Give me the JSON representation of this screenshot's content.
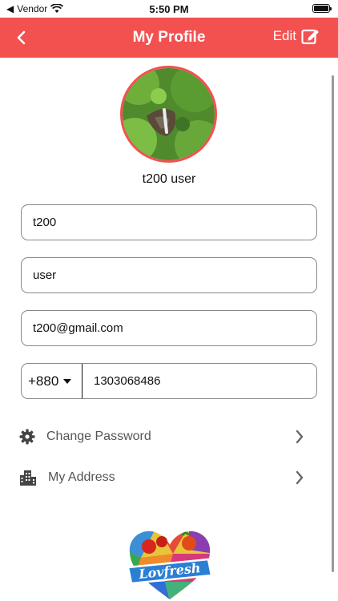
{
  "status_bar": {
    "carrier": "Vendor",
    "time": "5:50 PM"
  },
  "header": {
    "title": "My Profile",
    "edit_label": "Edit"
  },
  "profile": {
    "display_name": "t200 user"
  },
  "form": {
    "first_name": "t200",
    "last_name": "user",
    "email": "t200@gmail.com",
    "country_code": "+880",
    "phone": "1303068486"
  },
  "menu": {
    "change_password": "Change Password",
    "my_address": "My Address"
  },
  "brand": {
    "logo_text": "Lovfresh",
    "accent_color": "#f35050"
  }
}
